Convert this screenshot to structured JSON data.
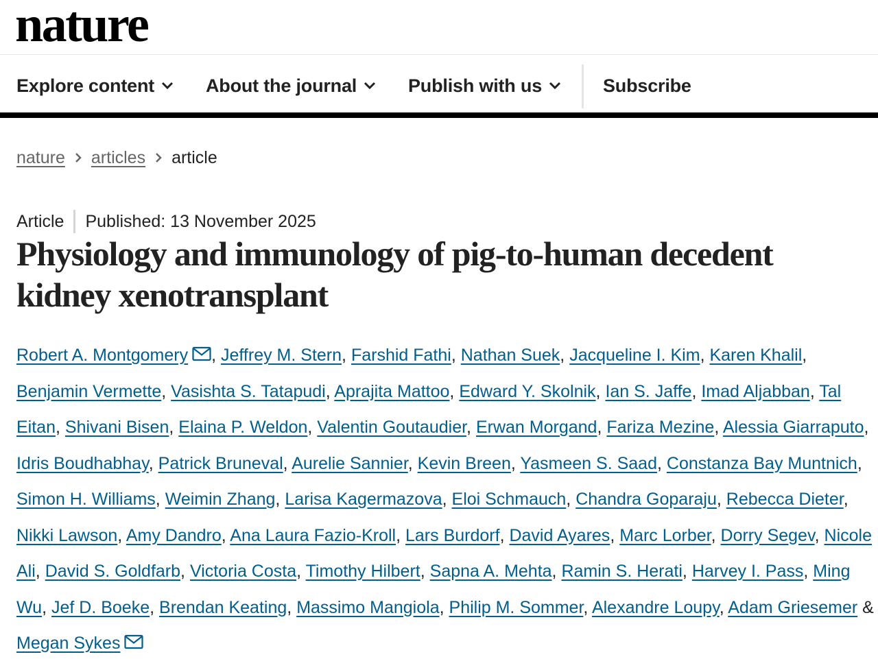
{
  "brand": {
    "logo_text": "nature"
  },
  "nav": {
    "items": [
      {
        "label": "Explore content",
        "has_dropdown": true,
        "icon": "chevron-down-icon"
      },
      {
        "label": "About the journal",
        "has_dropdown": true,
        "icon": "chevron-down-icon"
      },
      {
        "label": "Publish with us",
        "has_dropdown": true,
        "icon": "chevron-down-icon"
      }
    ],
    "subscribe_label": "Subscribe"
  },
  "breadcrumb": {
    "items": [
      {
        "label": "nature",
        "link": true
      },
      {
        "label": "articles",
        "link": true
      },
      {
        "label": "article",
        "link": false
      }
    ],
    "separator_icon": "chevron-right-icon"
  },
  "article": {
    "type": "Article",
    "published": "Published: 13 November 2025",
    "title": "Physiology and immunology of pig-to-human decedent kidney xenotransplant",
    "authors": [
      "Robert A. Montgomery",
      "Jeffrey M. Stern",
      "Farshid Fathi",
      "Nathan Suek",
      "Jacqueline I. Kim",
      "Karen Khalil",
      "Benjamin Vermette",
      "Vasishta S. Tatapudi",
      "Aprajita Mattoo",
      "Edward Y. Skolnik",
      "Ian S. Jaffe",
      "Imad Aljabban",
      "Tal Eitan",
      "Shivani Bisen",
      "Elaina P. Weldon",
      "Valentin Goutaudier",
      "Erwan Morgand",
      "Fariza Mezine",
      "Alessia Giarraputo",
      "Idris Boudhabhay",
      "Patrick Bruneval",
      "Aurelie Sannier",
      "Kevin Breen",
      "Yasmeen S. Saad",
      "Constanza Bay Muntnich",
      "Simon H. Williams",
      "Weimin Zhang",
      "Larisa Kagermazova",
      "Eloi Schmauch",
      "Chandra Goparaju",
      "Rebecca Dieter",
      "Nikki Lawson",
      "Amy Dandro",
      "Ana Laura Fazio-Kroll",
      "Lars Burdorf",
      "David Ayares",
      "Marc Lorber",
      "Dorry Segev",
      "Nicole Ali",
      "David S. Goldfarb",
      "Victoria Costa",
      "Timothy Hilbert",
      "Sapna A. Mehta",
      "Ramin S. Herati",
      "Harvey I. Pass",
      "Ming Wu",
      "Jef D. Boeke",
      "Brendan Keating",
      "Massimo Mangiola",
      "Philip M. Sommer",
      "Alexandre Loupy",
      "Adam Griesemer",
      "Megan Sykes"
    ],
    "corresponding_authors": [
      "Robert A. Montgomery",
      "Megan Sykes"
    ],
    "corresponding_icon": "mail-icon",
    "list_separator": ",",
    "final_separator": "&",
    "colors": {
      "author_link": "#025e8d",
      "text": "#222222"
    }
  }
}
